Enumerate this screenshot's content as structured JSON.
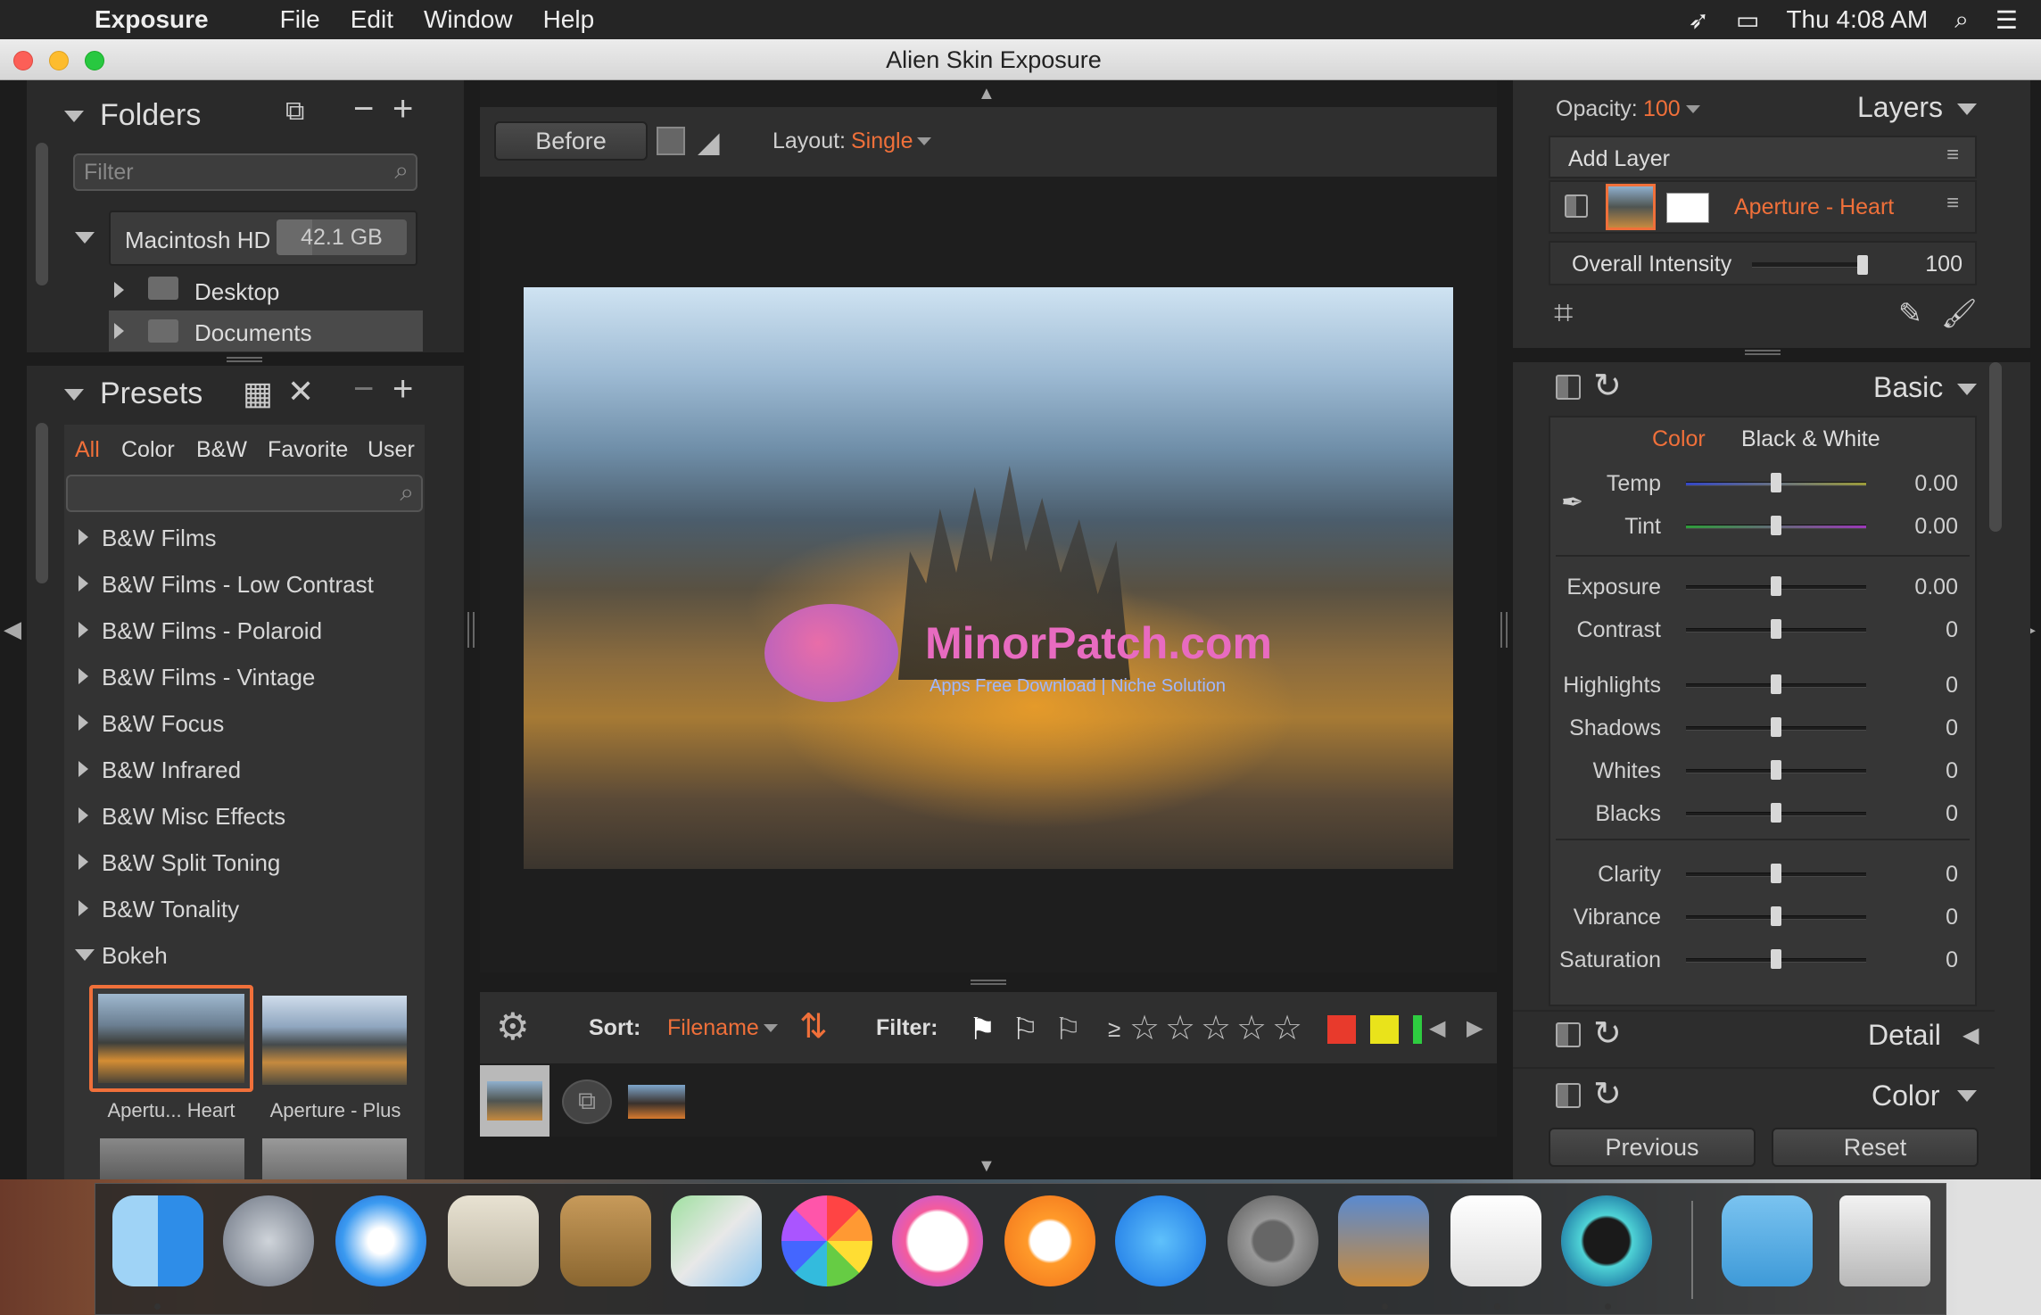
{
  "menubar": {
    "app_name": "Exposure",
    "menus": [
      "File",
      "Edit",
      "Window",
      "Help"
    ],
    "clock": "Thu 4:08 AM"
  },
  "window": {
    "title": "Alien Skin Exposure"
  },
  "folders": {
    "title": "Folders",
    "filter_placeholder": "Filter",
    "drive": {
      "name": "Macintosh HD",
      "size": "42.1 GB"
    },
    "items": [
      "Desktop",
      "Documents"
    ]
  },
  "presets": {
    "title": "Presets",
    "tabs": [
      "All",
      "Color",
      "B&W",
      "Favorite",
      "User"
    ],
    "active_tab": "All",
    "groups": [
      "B&W Films",
      "B&W Films - Low Contrast",
      "B&W Films - Polaroid",
      "B&W Films - Vintage",
      "B&W Focus",
      "B&W Infrared",
      "B&W Misc Effects",
      "B&W Split Toning",
      "B&W Tonality",
      "Bokeh"
    ],
    "thumbs": [
      "Apertu... Heart",
      "Aperture - Plus"
    ]
  },
  "viewer": {
    "before_label": "Before",
    "layout_label": "Layout:",
    "layout_value": "Single",
    "watermark_title": "MinorPatch.com",
    "watermark_sub": "Apps Free Download | Niche Solution"
  },
  "filmstrip_bar": {
    "sort_label": "Sort:",
    "sort_value": "Filename",
    "filter_label": "Filter:",
    "rating_prefix": "≥",
    "color_filters": [
      "#e83a2c",
      "#e9e31b",
      "#2ecc40"
    ]
  },
  "layers": {
    "opacity_label": "Opacity:",
    "opacity_value": "100",
    "title": "Layers",
    "add_layer": "Add Layer",
    "layer_name": "Aperture - Heart",
    "intensity_label": "Overall Intensity",
    "intensity_value": "100",
    "intensity_level": 1.0
  },
  "basic": {
    "title": "Basic",
    "mode_color": "Color",
    "mode_bw": "Black & White",
    "sliders": [
      {
        "label": "Temp",
        "value": "0.00"
      },
      {
        "label": "Tint",
        "value": "0.00"
      },
      {
        "label": "Exposure",
        "value": "0.00"
      },
      {
        "label": "Contrast",
        "value": "0"
      },
      {
        "label": "Highlights",
        "value": "0"
      },
      {
        "label": "Shadows",
        "value": "0"
      },
      {
        "label": "Whites",
        "value": "0"
      },
      {
        "label": "Blacks",
        "value": "0"
      },
      {
        "label": "Clarity",
        "value": "0"
      },
      {
        "label": "Vibrance",
        "value": "0"
      },
      {
        "label": "Saturation",
        "value": "0"
      }
    ]
  },
  "sections": {
    "detail": "Detail",
    "color": "Color"
  },
  "buttons": {
    "previous": "Previous",
    "reset": "Reset"
  },
  "colors": {
    "accent": "#f0703a",
    "panel": "#2d2d2d",
    "background": "#1c1c1c"
  }
}
